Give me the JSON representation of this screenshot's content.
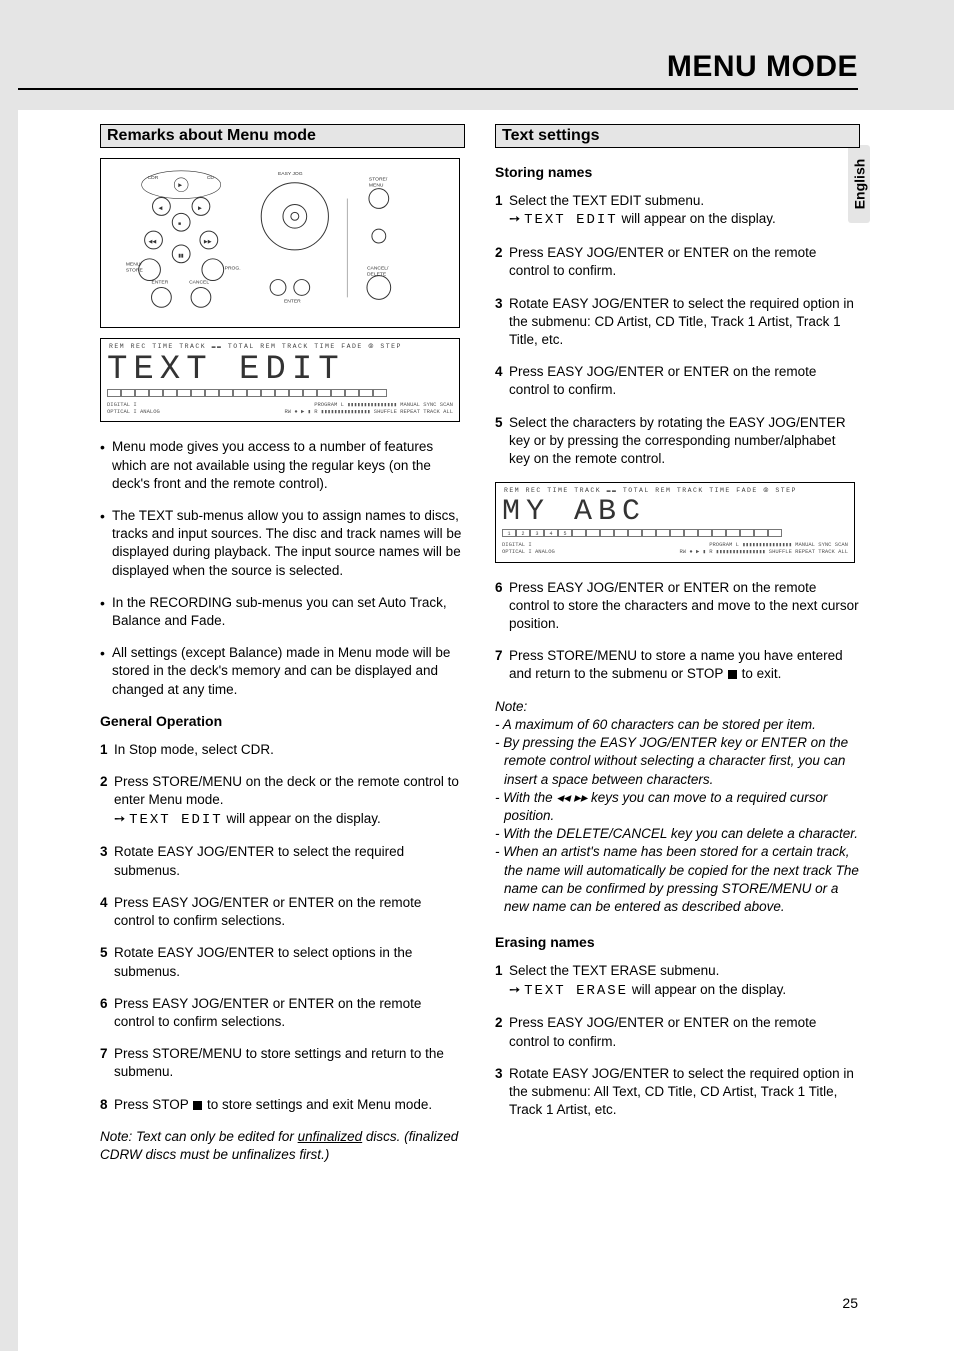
{
  "page": {
    "title": "MENU MODE",
    "language_tab": "English",
    "page_number": "25"
  },
  "left": {
    "header": "Remarks about Menu mode",
    "display1": {
      "top_labels": "REM  REC  TIME  TRACK  ▬▬  TOTAL  REM  TRACK  TIME  FADE  ⦾  STEP",
      "main_text": "TEXT EDIT",
      "bottom_row1_left": "DIGITAL I",
      "bottom_row1_mid": "PROGRAM   L ▮▮▮▮▮▮▮▮▮▮▮▮▮▮▮  MANUAL  SYNC      SCAN",
      "bottom_row2_left": "OPTICAL I  ANALOG",
      "bottom_row2_mid": "RW ● ▶ ▮   R ▮▮▮▮▮▮▮▮▮▮▮▮▮▮▮  SHUFFLE REPEAT TRACK ALL"
    },
    "bullets": [
      "Menu mode gives you access to a number of features which are not available using the regular keys (on the deck's front and the remote control).",
      "The TEXT sub-menus allow you to assign names to discs, tracks and input sources. The disc and track names will be displayed during playback. The input source names will be displayed when the source is selected.",
      "In the RECORDING sub-menus you can set Auto Track, Balance and Fade.",
      "All settings (except Balance) made in Menu mode will be stored in the deck's memory and can be displayed and changed at any time."
    ],
    "general_heading": "General Operation",
    "steps": {
      "s1": "In Stop mode, select CDR.",
      "s2_a": "Press STORE/MENU on the deck or the remote control to enter Menu mode.",
      "s2_b_seg": "TEXT EDIT",
      "s2_b_rest": " will appear on the display.",
      "s3": "Rotate EASY JOG/ENTER to select the required submenus.",
      "s4": "Press EASY JOG/ENTER or ENTER on the remote control to confirm  selections.",
      "s5": "Rotate EASY JOG/ENTER to select options in the submenus.",
      "s6": "Press EASY JOG/ENTER or ENTER on the remote control to confirm  selections.",
      "s7": "Press STORE/MENU to store settings and return to the submenu.",
      "s8_a": "Press STOP ",
      "s8_b": " to store settings and exit Menu mode."
    },
    "note_a": "Note: Text can only be edited for ",
    "note_u": "unfinalized",
    "note_b": " discs. (finalized CDRW discs must be unfinalizes first.)"
  },
  "right": {
    "header": "Text settings",
    "storing_heading": "Storing names",
    "storing": {
      "s1_a": "Select the TEXT EDIT submenu.",
      "s1_b_seg": "TEXT EDIT",
      "s1_b_rest": " will appear on the display.",
      "s2": "Press EASY JOG/ENTER or ENTER on the remote control to confirm.",
      "s3": "Rotate EASY JOG/ENTER to select the required option in the submenu: CD  Artist, CD Title, Track 1 Artist, Track 1 Title, etc.",
      "s4": "Press EASY JOG/ENTER or ENTER on the remote control to confirm.",
      "s5": "Select the characters by rotating the EASY JOG/ENTER key or by pressing  the corresponding number/alphabet key on the remote control."
    },
    "display2": {
      "top_labels": "REM  REC  TIME  TRACK  ▬▬  TOTAL  REM  TRACK  TIME  FADE  ⦾  STEP",
      "main_text": "MY   ABC",
      "cells": [
        "1",
        "2",
        "3",
        "4",
        "5",
        "",
        "",
        "",
        "",
        "",
        "",
        "",
        "",
        "",
        "",
        "",
        "",
        "",
        "",
        ""
      ],
      "bottom_row1_left": "DIGITAL I",
      "bottom_row1_mid": "PROGRAM   L ▮▮▮▮▮▮▮▮▮▮▮▮▮▮▮  MANUAL  SYNC      SCAN",
      "bottom_row2_left": "OPTICAL I  ANALOG",
      "bottom_row2_mid": "RW ● ▶ ▮   R ▮▮▮▮▮▮▮▮▮▮▮▮▮▮▮  SHUFFLE REPEAT TRACK ALL"
    },
    "storing2": {
      "s6": "Press EASY JOG/ENTER or ENTER on the remote control to store the characters and move to the next cursor position.",
      "s7_a": "Press STORE/MENU to store a name you have entered and return to the submenu or STOP ",
      "s7_b": " to exit."
    },
    "note_heading": "Note:",
    "notes": [
      "- A maximum of 60 characters can be stored per item.",
      "- By pressing the EASY JOG/ENTER key or ENTER on the remote control without selecting a character first, you can insert a space between characters.",
      "- With the ◂◂  ▸▸ keys you can move to a required cursor position.",
      "- With the DELETE/CANCEL key you can delete a character.",
      "- When an artist's name has been stored for a certain track, the name will automatically be copied for the next track The name can be confirmed by pressing STORE/MENU or a new name can be entered as described above."
    ],
    "erasing_heading": "Erasing names",
    "erasing": {
      "s1_a": "Select the TEXT ERASE submenu.",
      "s1_b_seg": "TEXT ERASE",
      "s1_b_rest": " will appear on the display.",
      "s2": "Press EASY JOG/ENTER or ENTER on the remote control to confirm.",
      "s3": "Rotate EASY JOG/ENTER to select the required option in the submenu: All Text, CD Title, CD Artist, Track 1 Title, Track 1 Artist, etc."
    }
  },
  "panel_labels": {
    "cdr": "CDR",
    "cd": "CD",
    "menu_store": "MENU/\nSTORE",
    "prog": "PROG.",
    "enter": "ENTER",
    "cancel": "CANCEL",
    "easy_jog": "EASY JOG",
    "store_menu": "STORE/\nMENU",
    "cancel_delete": "CANCEL/\nDELETE"
  }
}
